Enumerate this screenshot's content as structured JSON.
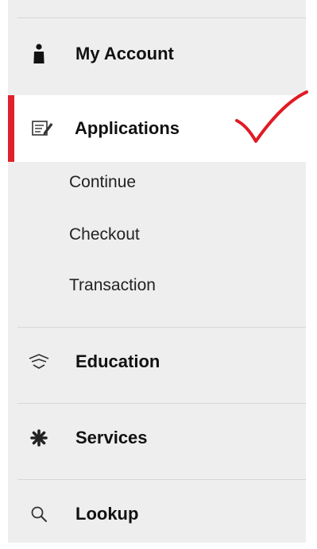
{
  "menu": {
    "my_account": {
      "label": "My Account",
      "icon": "person-icon"
    },
    "applications": {
      "label": "Applications",
      "icon": "form-edit-icon",
      "active": true,
      "accent": "#e0202a",
      "sub_items": [
        "Continue",
        "Checkout",
        "Transaction"
      ]
    },
    "education": {
      "label": "Education",
      "icon": "graduation-cap-icon"
    },
    "services": {
      "label": "Services",
      "icon": "asterisk-icon"
    },
    "lookup": {
      "label": "Lookup",
      "icon": "search-icon"
    }
  },
  "annotation": {
    "type": "red-checkmark",
    "color": "#e01b24"
  }
}
